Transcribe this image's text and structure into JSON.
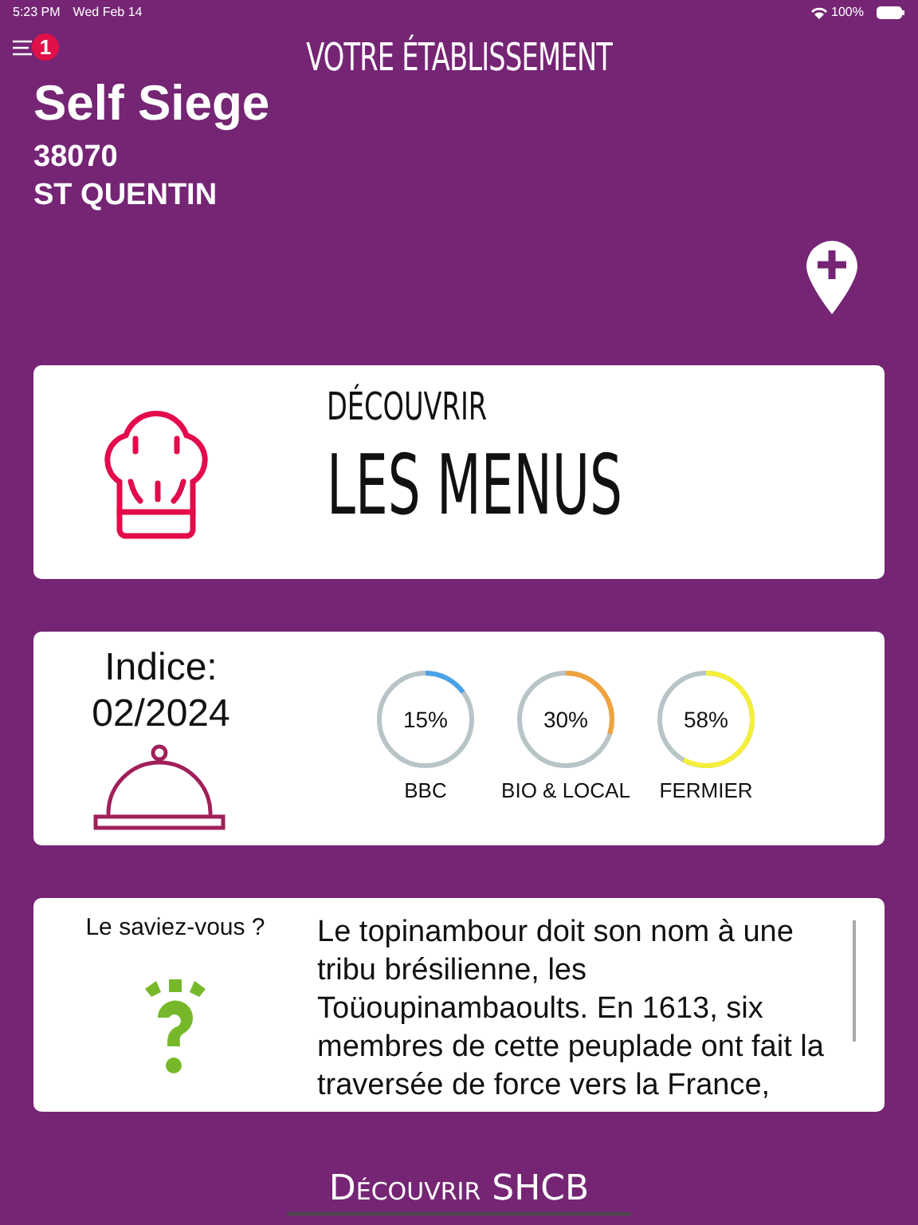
{
  "status_bar": {
    "time": "5:23 PM",
    "date": "Wed Feb 14",
    "battery": "100%"
  },
  "header": {
    "title": "VOTRE ÉTABLISSEMENT",
    "badge": "1"
  },
  "establishment": {
    "name": "Self Siege",
    "postcode": "38070",
    "city": "ST QUENTIN"
  },
  "menu_card": {
    "kicker": "DÉCOUVRIR",
    "title": "LES MENUS"
  },
  "index_card": {
    "label": "Indice:",
    "period": "02/2024",
    "meters": [
      {
        "value": "15%",
        "label": "BBC",
        "level": 0.15,
        "color": "#4aa3e8"
      },
      {
        "value": "30%",
        "label": "BIO & LOCAL",
        "level": 0.3,
        "color": "#f0a23c"
      },
      {
        "value": "58%",
        "label": "FERMIER",
        "level": 0.58,
        "color": "#f5ef3a"
      }
    ]
  },
  "fact_card": {
    "title": "Le saviez-vous ?",
    "text": "Le topinambour doit son nom à une tribu brésilienne, les Toüoupinambaoults. En 1613, six membres de cette peuplade ont fait la traversée de force vers la France,"
  },
  "footer": {
    "link": "Découvrir SHCB"
  }
}
